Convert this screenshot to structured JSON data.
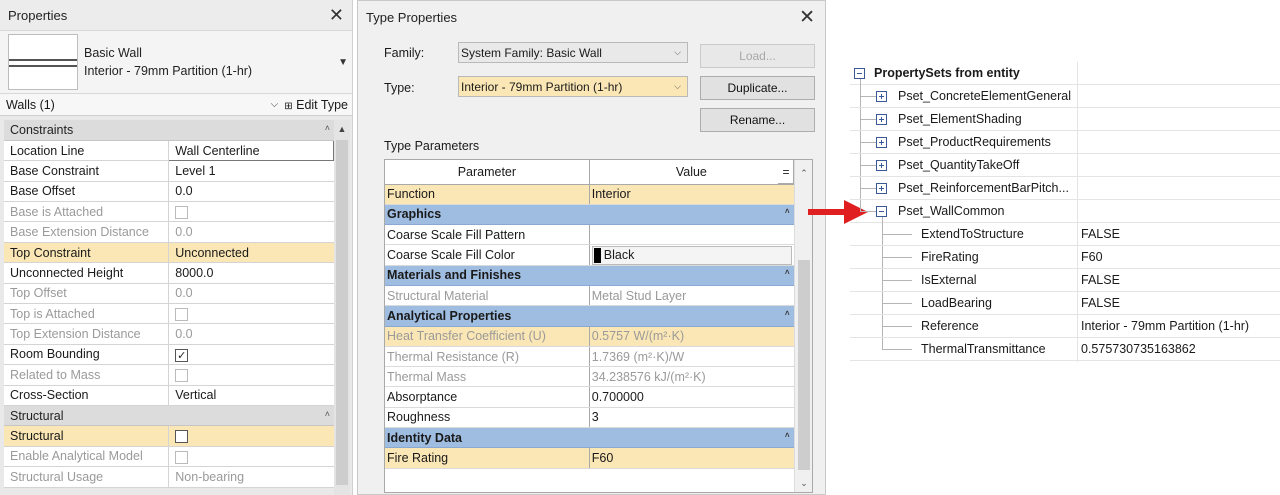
{
  "properties": {
    "title": "Properties",
    "type_family": "Basic Wall",
    "type_name": "Interior - 79mm Partition (1-hr)",
    "filter": "Walls (1)",
    "edit_type": "Edit Type",
    "rows": [
      {
        "kind": "group",
        "label": "Constraints"
      },
      {
        "label": "Location Line",
        "value": "Wall Centerline",
        "editing": true
      },
      {
        "label": "Base Constraint",
        "value": "Level 1"
      },
      {
        "label": "Base Offset",
        "value": "0.0"
      },
      {
        "label": "Base is Attached",
        "check": "off",
        "dim": true
      },
      {
        "label": "Base Extension Distance",
        "value": "0.0",
        "dim": true
      },
      {
        "label": "Top Constraint",
        "value": "Unconnected",
        "highlight": true
      },
      {
        "label": "Unconnected Height",
        "value": "8000.0"
      },
      {
        "label": "Top Offset",
        "value": "0.0",
        "dim": true
      },
      {
        "label": "Top is Attached",
        "check": "off",
        "dim": true
      },
      {
        "label": "Top Extension Distance",
        "value": "0.0",
        "dim": true
      },
      {
        "label": "Room Bounding",
        "check": "on"
      },
      {
        "label": "Related to Mass",
        "check": "off",
        "dim": true
      },
      {
        "label": "Cross-Section",
        "value": "Vertical"
      },
      {
        "kind": "group",
        "label": "Structural"
      },
      {
        "label": "Structural",
        "check": "dark",
        "highlight": true
      },
      {
        "label": "Enable Analytical Model",
        "check": "off",
        "dim": true
      },
      {
        "label": "Structural Usage",
        "value": "Non-bearing",
        "dim": true
      }
    ]
  },
  "type_properties": {
    "title": "Type Properties",
    "family_label": "Family:",
    "family_value": "System Family: Basic Wall",
    "type_label": "Type:",
    "type_value": "Interior - 79mm Partition (1-hr)",
    "load_button": "Load...",
    "duplicate_button": "Duplicate...",
    "rename_button": "Rename...",
    "section_label": "Type Parameters",
    "col_parameter": "Parameter",
    "col_value": "Value",
    "col_eq": "=",
    "rows": [
      {
        "label": "Function",
        "value": "Interior",
        "highlight": true
      },
      {
        "kind": "group",
        "label": "Graphics"
      },
      {
        "label": "Coarse Scale Fill Pattern",
        "value": ""
      },
      {
        "label": "Coarse Scale Fill Color",
        "value": "Black",
        "color": "#000000"
      },
      {
        "kind": "group",
        "label": "Materials and Finishes"
      },
      {
        "label": "Structural Material",
        "value": "Metal Stud Layer",
        "dim": true
      },
      {
        "kind": "group",
        "label": "Analytical Properties"
      },
      {
        "label": "Heat Transfer Coefficient (U)",
        "value": "0.5757 W/(m²·K)",
        "dim": true,
        "highlight": true
      },
      {
        "label": "Thermal Resistance (R)",
        "value": "1.7369 (m²·K)/W",
        "dim": true
      },
      {
        "label": "Thermal Mass",
        "value": "34.238576 kJ/(m²·K)",
        "dim": true
      },
      {
        "label": "Absorptance",
        "value": "0.700000"
      },
      {
        "label": "Roughness",
        "value": "3"
      },
      {
        "kind": "group",
        "label": "Identity Data"
      },
      {
        "label": "Fire Rating",
        "value": "F60",
        "highlight": true
      }
    ]
  },
  "ifc_tree": {
    "root": "PropertySets from entity",
    "psets": [
      {
        "label": "Pset_ConcreteElementGeneral",
        "expanded": false
      },
      {
        "label": "Pset_ElementShading",
        "expanded": false
      },
      {
        "label": "Pset_ProductRequirements",
        "expanded": false
      },
      {
        "label": "Pset_QuantityTakeOff",
        "expanded": false
      },
      {
        "label": "Pset_ReinforcementBarPitch...",
        "expanded": false
      },
      {
        "label": "Pset_WallCommon",
        "expanded": true
      }
    ],
    "wall_common_props": [
      {
        "label": "ExtendToStructure",
        "value": "FALSE"
      },
      {
        "label": "FireRating",
        "value": "F60"
      },
      {
        "label": "IsExternal",
        "value": "FALSE"
      },
      {
        "label": "LoadBearing",
        "value": "FALSE"
      },
      {
        "label": "Reference",
        "value": "Interior - 79mm Partition (1-hr)"
      },
      {
        "label": "ThermalTransmittance",
        "value": "0.575730735163862"
      }
    ]
  },
  "colors": {
    "highlight": "#fbe7b5",
    "group_blue": "#9fbde0",
    "arrow_red": "#e02020"
  }
}
